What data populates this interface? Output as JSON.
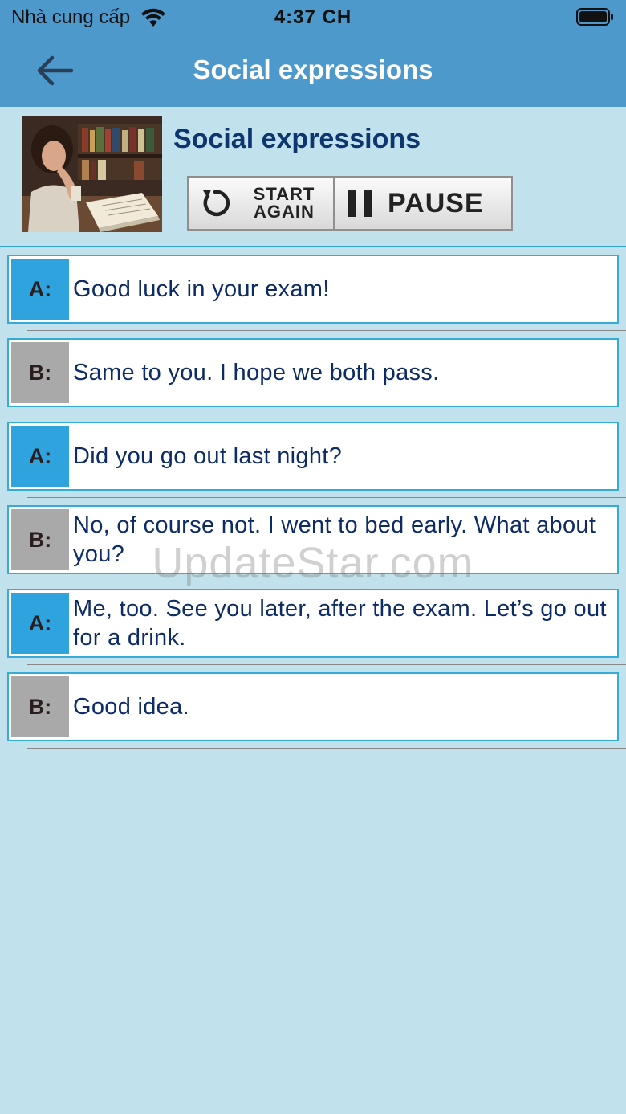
{
  "status_bar": {
    "carrier": "Nhà cung cấp",
    "time": "4:37 CH"
  },
  "nav": {
    "title": "Social expressions"
  },
  "lesson": {
    "title": "Social expressions",
    "start_again_line1": "START",
    "start_again_line2": "AGAIN",
    "pause_label": "PAUSE"
  },
  "dialogue": [
    {
      "speaker": "A:",
      "text": "Good luck in your exam!"
    },
    {
      "speaker": "B:",
      "text": "Same to you. I hope we both pass."
    },
    {
      "speaker": "A:",
      "text": "Did you go out last night?"
    },
    {
      "speaker": "B:",
      "text": "No, of course not. I went to bed early. What about you?"
    },
    {
      "speaker": "A:",
      "text": "Me, too. See you later, after the exam. Let’s go out for a drink."
    },
    {
      "speaker": "B:",
      "text": "Good idea."
    }
  ],
  "watermark": "UpdateStar.com",
  "colors": {
    "header": "#4d99cc",
    "background": "#c1e2ec",
    "speaker_a": "#2fa3dd",
    "speaker_b": "#a9a9a9",
    "text": "#0d2b66"
  }
}
